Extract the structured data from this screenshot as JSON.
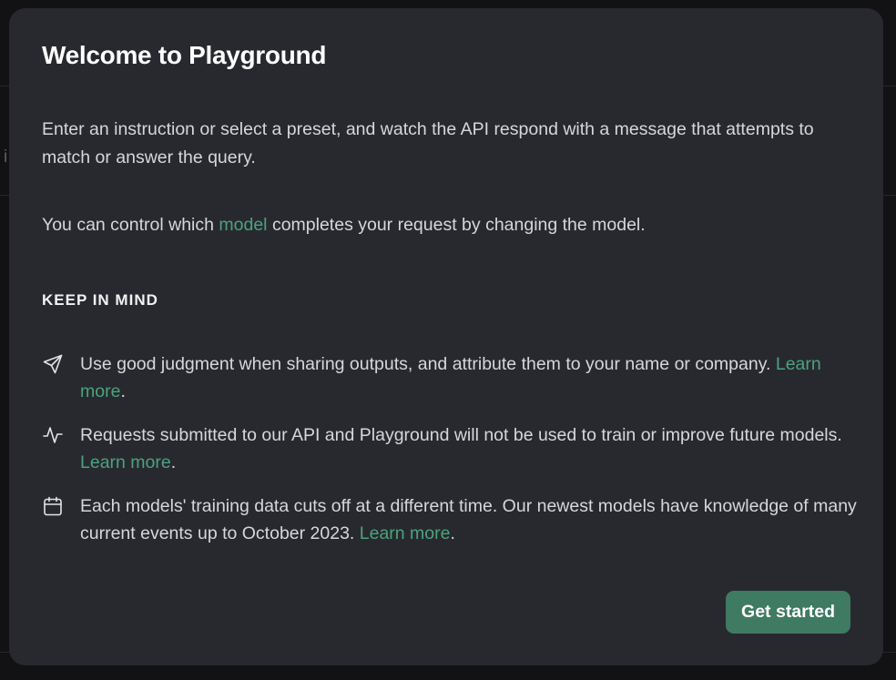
{
  "background": {
    "fragment_text": "i"
  },
  "modal": {
    "title": "Welcome to Playground",
    "intro": "Enter an instruction or select a preset, and watch the API respond with a message that attempts to match or answer the query.",
    "model_para": {
      "before": "You can control which ",
      "link": "model",
      "after": " completes your request by changing the model."
    },
    "keep_in_mind_heading": "KEEP IN MIND",
    "items": [
      {
        "icon": "send-icon",
        "text": "Use good judgment when sharing outputs, and attribute them to your name or company. ",
        "link": "Learn more",
        "trailing": "."
      },
      {
        "icon": "activity-icon",
        "text": "Requests submitted to our API and Playground will not be used to train or improve future models. ",
        "link": "Learn more",
        "trailing": "."
      },
      {
        "icon": "calendar-icon",
        "text": "Each models' training data cuts off at a different time. Our newest models have knowledge of many current events up to October 2023. ",
        "link": "Learn more",
        "trailing": "."
      }
    ],
    "button_label": "Get started"
  },
  "colors": {
    "modal_bg": "#28292e",
    "link": "#4aa37e",
    "button_bg": "#3f7a63",
    "text": "#d6d7da",
    "title": "#ffffff"
  }
}
